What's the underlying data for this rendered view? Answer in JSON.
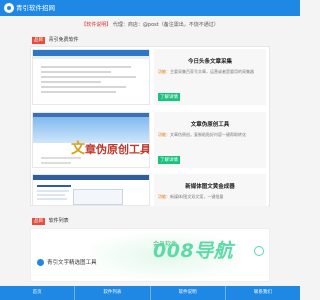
{
  "header": {
    "site_name": "青引软件招网"
  },
  "notice": {
    "prefix": "【软件说明】",
    "body": "代理：商店：@post（备注需出，不烧不通过）"
  },
  "apps_section": {
    "tag": "品目",
    "title": "青引免费软件"
  },
  "cards": [
    {
      "name": "今日头条文章采集",
      "desc_label": "功能：",
      "desc": "主要采集百家号文章，运营或者是要用的采集器",
      "button": "了解详情"
    },
    {
      "name": "文章伪原创工具",
      "desc_label": "功能：",
      "desc": "文章伪原创，复制粘贴好内容一键帮助转化",
      "button": "了解详情",
      "thumb_text_first": "文",
      "thumb_text_rest": "章伪原创工具"
    },
    {
      "name": "新媒体图文黄金成器",
      "desc_label": "功能：",
      "desc": "新媒体/图文双文案，一键批量",
      "button": "了解详情"
    }
  ],
  "promo_section": {
    "tag": "品目",
    "title": "软件列表"
  },
  "promo": {
    "vip": "会员软件",
    "app_name": "青引文字精选图工具"
  },
  "watermark": {
    "text": "008导航"
  },
  "bottom_nav": [
    "首页",
    "软件列表",
    "软件说明",
    "联系我们"
  ],
  "colors": {
    "primary": "#1f88e5",
    "button": "#19c37d",
    "tag": "#e74c3c",
    "watermark": "#5fd9a8"
  }
}
